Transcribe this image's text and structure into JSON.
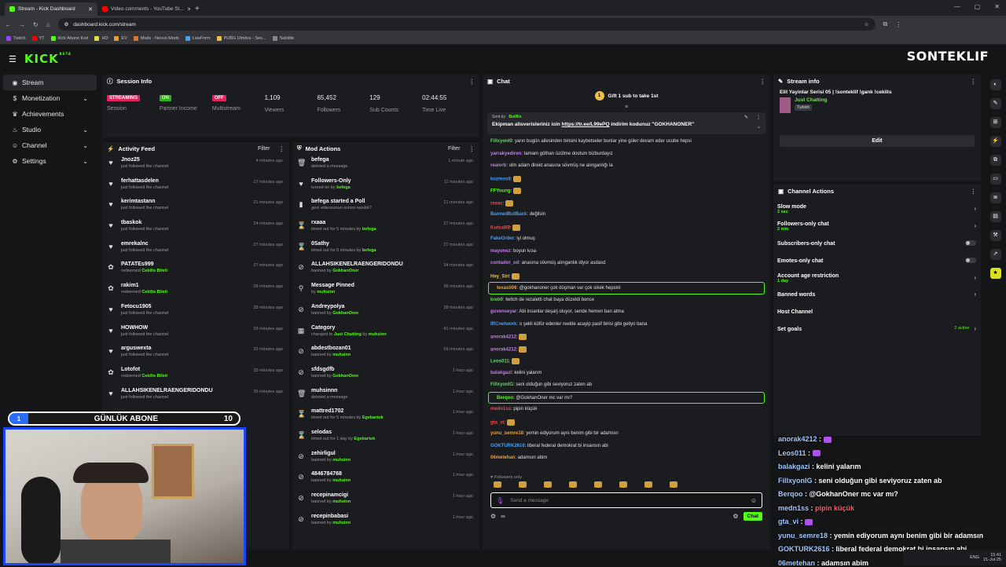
{
  "browser": {
    "tabs": [
      {
        "title": "Stream - Kick Dashboard",
        "active": true,
        "color": "#53fc18"
      },
      {
        "title": "Video comments - YouTube St...",
        "active": false,
        "color": "#ff0000"
      }
    ],
    "url": "dashboard.kick.com/stream",
    "bookmarks": [
      "Twitch",
      "YT",
      "Kick Abone Kod",
      "HD",
      "EV",
      "Mods - Nexus Mods",
      "LawForm",
      "PUBG Ulmbra - Seo...",
      "Subtitle"
    ]
  },
  "brand": {
    "logo": "KICK",
    "beta": "BETA",
    "accent": "#53fc18"
  },
  "streamer_name": "SONTEKLIF",
  "sidebar": {
    "items": [
      {
        "label": "Stream",
        "icon": "broadcast-icon",
        "active": true,
        "chevron": false
      },
      {
        "label": "Monetization",
        "icon": "money-icon",
        "active": false,
        "chevron": true
      },
      {
        "label": "Achievements",
        "icon": "trophy-icon",
        "active": false,
        "chevron": false
      },
      {
        "label": "Studio",
        "icon": "studio-icon",
        "active": false,
        "chevron": true
      },
      {
        "label": "Channel",
        "icon": "user-icon",
        "active": false,
        "chevron": true
      },
      {
        "label": "Settings",
        "icon": "gear-icon",
        "active": false,
        "chevron": true
      }
    ]
  },
  "session": {
    "title": "Session Info",
    "stats": [
      {
        "pill": "STREAMING",
        "pill_color": "#e0245e",
        "value": "",
        "label": "Session"
      },
      {
        "pill": "ON",
        "pill_color": "#2fb31b",
        "value": "",
        "label": "Partner Income"
      },
      {
        "pill": "OFF",
        "pill_color": "#e0245e",
        "value": "",
        "label": "Multistream"
      },
      {
        "pill": "",
        "value": "1,109",
        "label": "Viewers"
      },
      {
        "pill": "",
        "value": "65,452",
        "label": "Followers"
      },
      {
        "pill": "",
        "value": "129",
        "label": "Sub Counts"
      },
      {
        "pill": "",
        "value": "02:44:55",
        "label": "Time Live"
      }
    ]
  },
  "activity": {
    "title": "Activity Feed",
    "filter": "Filter",
    "items": [
      {
        "name": "Jnoz25",
        "sub": "just followed the channel",
        "time": "4 minutes ago",
        "icon": "heart-icon"
      },
      {
        "name": "ferhattasdelen",
        "sub": "just followed the channel",
        "time": "17 minutes ago",
        "icon": "heart-icon"
      },
      {
        "name": "kerimtastann",
        "sub": "just followed the channel",
        "time": "21 minutes ago",
        "icon": "heart-icon"
      },
      {
        "name": "tbaskok",
        "sub": "just followed the channel",
        "time": "24 minutes ago",
        "icon": "heart-icon"
      },
      {
        "name": "emrekalnc",
        "sub": "just followed the channel",
        "time": "27 minutes ago",
        "icon": "heart-icon"
      },
      {
        "name": "PATATEs999",
        "sub": "redeemed",
        "reward": "Cekilis Bileti",
        "time": "27 minutes ago",
        "icon": "reward-icon"
      },
      {
        "name": "rakim1",
        "sub": "redeemed",
        "reward": "Cekilis Bileti",
        "time": "28 minutes ago",
        "icon": "reward-icon"
      },
      {
        "name": "Fetocu1905",
        "sub": "just followed the channel",
        "time": "28 minutes ago",
        "icon": "heart-icon"
      },
      {
        "name": "HOWHOW",
        "sub": "just followed the channel",
        "time": "29 minutes ago",
        "icon": "heart-icon"
      },
      {
        "name": "arguswexta",
        "sub": "just followed the channel",
        "time": "32 minutes ago",
        "icon": "heart-icon"
      },
      {
        "name": "Lotofot",
        "sub": "redeemed",
        "reward": "Cekilis Bileti",
        "time": "35 minutes ago",
        "icon": "reward-icon"
      },
      {
        "name": "ALLAHSIKENELRAENGERIDONDU",
        "sub": "just followed the channel",
        "time": "35 minutes ago",
        "icon": "heart-icon"
      }
    ]
  },
  "mod": {
    "title": "Mod Actions",
    "filter": "Filter",
    "items": [
      {
        "name": "befega",
        "sub": "deleted a message",
        "time": "1 minute ago",
        "icon": "trash-icon"
      },
      {
        "name": "Followers-Only",
        "sub": "turned on by",
        "by": "befega",
        "time": "11 minutes ago",
        "icon": "heart-icon"
      },
      {
        "name": "befega started a Poll",
        "sub": "gezi videosunun süresi nasıldı?",
        "time": "21 minutes ago",
        "icon": "poll-icon"
      },
      {
        "name": "rxaaa",
        "sub": "timed out for 5 minutes by",
        "by": "befega",
        "time": "27 minutes ago",
        "icon": "hourglass-icon"
      },
      {
        "name": "0Sathy",
        "sub": "timed out for 5 minutes by",
        "by": "befega",
        "time": "27 minutes ago",
        "icon": "hourglass-icon"
      },
      {
        "name": "ALLAHSIKENELRAENGERIDONDU",
        "sub": "banned by",
        "by": "GokhanOner",
        "time": "34 minutes ago",
        "icon": "ban-icon"
      },
      {
        "name": "Message Pinned",
        "sub": "by",
        "by": "muhsinn",
        "time": "36 minutes ago",
        "icon": "pin-icon"
      },
      {
        "name": "Andreypolya",
        "sub": "banned by",
        "by": "GokhanOner",
        "time": "38 minutes ago",
        "icon": "ban-icon"
      },
      {
        "name": "Category",
        "sub": "changed to",
        "by": "Just Chatting",
        "extra": "muhsinn",
        "time": "41 minutes ago",
        "icon": "category-icon"
      },
      {
        "name": "abdestbozan01",
        "sub": "banned by",
        "by": "muhsinn",
        "time": "59 minutes ago",
        "icon": "ban-icon"
      },
      {
        "name": "sfdsgdfb",
        "sub": "banned by",
        "by": "GokhanOner",
        "time": "1 hour ago",
        "icon": "ban-icon"
      },
      {
        "name": "muhsinnn",
        "sub": "deleted a message",
        "time": "1 hour ago",
        "icon": "trash-icon"
      },
      {
        "name": "mattred1702",
        "sub": "timed out for 5 minutes by",
        "by": "Egebartok",
        "time": "1 hour ago",
        "icon": "hourglass-icon"
      },
      {
        "name": "selodas",
        "sub": "timed out for 1 day by",
        "by": "Egebartok",
        "time": "1 hour ago",
        "icon": "hourglass-icon"
      },
      {
        "name": "zehirligul",
        "sub": "banned by",
        "by": "muhsinn",
        "time": "1 hour ago",
        "icon": "ban-icon"
      },
      {
        "name": "4846784768",
        "sub": "banned by",
        "by": "muhsinn",
        "time": "1 hour ago",
        "icon": "ban-icon"
      },
      {
        "name": "recepinamcigi",
        "sub": "banned by",
        "by": "muhsinn",
        "time": "1 hour ago",
        "icon": "ban-icon"
      },
      {
        "name": "recepinbabasi",
        "sub": "banned by",
        "by": "muhsinn",
        "time": "1 hour ago",
        "icon": "ban-icon"
      }
    ]
  },
  "chat": {
    "title": "Chat",
    "gift": "Gift 1 sub to take 1st",
    "pinned_sender_label": "Sent by",
    "pinned_sender": "BotRix",
    "pinned_text": "Ekipman alisverisleriniz icin",
    "pinned_link": "https://tr.ee/L99ePQ",
    "pinned_tail": "indirim kodunuz \"GOKHANONER\"",
    "messages": [
      {
        "user": "Fillxyonl0",
        "color": "#6fd16f",
        "text": "yarın bugün ailesinden birisini kaybetseler bunlar yine güler devam eder ucube hepsi"
      },
      {
        "user": "yarrakyediren",
        "color": "#c27ee6",
        "text": "tamam göthan üzülme dostum bizburdayız"
      },
      {
        "user": "realorb",
        "color": "#c27ee6",
        "text": "olm adam direkt anasına sövmüş ne alınganlığı la"
      },
      {
        "user": "kozmosll",
        "color": "#4d9ff0",
        "text": ""
      },
      {
        "user": "FFYoung",
        "color": "#53fc18",
        "text": ""
      },
      {
        "user": "rxeac",
        "color": "#e84d4d",
        "text": ""
      },
      {
        "user": "BannedButBack",
        "color": "#4d9ff0",
        "text": "değilsin"
      },
      {
        "user": "Kutsal69",
        "color": "#e84d4d",
        "text": ""
      },
      {
        "user": "FakeOrder",
        "color": "#4d9ff0",
        "text": "iyi olmuş"
      },
      {
        "user": "mayonez",
        "color": "#c27ee6",
        "text": "boyun kısa"
      },
      {
        "user": "contador_od",
        "color": "#c27ee6",
        "text": "anasına sövmüş alınganlık diyor asdasd"
      },
      {
        "user": "Hey_Siri",
        "color": "#f0c040",
        "text": ""
      },
      {
        "user": "texasli06",
        "color": "#e8a040",
        "text": "@gokhanoner çok düşman var çok sikek hepsini",
        "highlight": true
      },
      {
        "user": "kreb0",
        "color": "#6fd16f",
        "text": "twitch de rezaletti chat baya düzeldi bence"
      },
      {
        "user": "guvenseyar",
        "color": "#c27ee6",
        "text": "Abi insanlar deşarj oluyor, sende hemen ban atma"
      },
      {
        "user": "IRCnetwork",
        "color": "#4d9ff0",
        "text": "o şekli küfür edenler reelde acayip pasif birisi gibi geliyo bana"
      },
      {
        "user": "anorak4212",
        "color": "#c27ee6",
        "text": ""
      },
      {
        "user": "anorak4212",
        "color": "#c27ee6",
        "text": ""
      },
      {
        "user": "Leos011",
        "color": "#6fd16f",
        "text": ""
      },
      {
        "user": "balakgazi",
        "color": "#c27ee6",
        "text": "kelini yalarım"
      },
      {
        "user": "FillxyonIG",
        "color": "#6fd16f",
        "text": "seni olduğun gibi seviyoruz zaten ab"
      },
      {
        "user": "Berqoo",
        "color": "#53fc18",
        "text": "@GokhanOner mc var mı?",
        "highlight": true
      },
      {
        "user": "medn1ss",
        "color": "#e84d4d",
        "text": "pipin küçük"
      },
      {
        "user": "gta_vi",
        "color": "#e84d4d",
        "text": ""
      },
      {
        "user": "yunu_semre18",
        "color": "#e8a040",
        "text": "yemin ediyorum aynı benim gibi bir adamsın"
      },
      {
        "user": "GOKTURK2616",
        "color": "#4d9ff0",
        "text": "liberal federal demokrat bi insansın abi"
      },
      {
        "user": "06metehan",
        "color": "#e8a040",
        "text": "adamsın abim"
      }
    ],
    "followers_only": "Followers only",
    "placeholder": "Send a message",
    "send_label": "Chat"
  },
  "stream_info": {
    "title": "Stream info",
    "stream_title": "Elit Yayinlar Serisi 05 | !sonteklif !gank !cekilis",
    "category": "Just Chatting",
    "language": "Turkish",
    "edit_label": "Edit"
  },
  "channel_actions": {
    "title": "Channel Actions",
    "items": [
      {
        "label": "Slow mode",
        "sub": "2 sec",
        "control": "chevron"
      },
      {
        "label": "Followers-only chat",
        "sub": "2 min",
        "control": "chevron"
      },
      {
        "label": "Subscribers-only chat",
        "sub": "",
        "control": "toggle"
      },
      {
        "label": "Emotes-only chat",
        "sub": "",
        "control": "toggle"
      },
      {
        "label": "Account age restriction",
        "sub": "1 day",
        "control": "chevron"
      },
      {
        "label": "Banned words",
        "sub": "",
        "control": "chevron"
      },
      {
        "label": "Host Channel",
        "sub": "",
        "control": "none"
      },
      {
        "label": "Set goals",
        "sub": "",
        "control": "chevron",
        "badge": "2 active"
      }
    ]
  },
  "overlay_chat": [
    {
      "user": "anorak4212",
      "color": "#b878f0",
      "text": ""
    },
    {
      "user": "Leos011",
      "color": "#fff",
      "text": ""
    },
    {
      "user": "balakgazi",
      "color": "#ffffff",
      "text": "kelini yalarım"
    },
    {
      "user": "FillxyonIG",
      "color": "#ffffff",
      "text": "seni olduğun gibi seviyoruz zaten ab"
    },
    {
      "user": "Berqoo",
      "color": "#ffffff",
      "text": "@GokhanOner mc var mı?"
    },
    {
      "user": "medn1ss",
      "color": "#ff5a5a",
      "text": "pipin küçük"
    },
    {
      "user": "gta_vi",
      "color": "#ff5a5a",
      "text": ""
    },
    {
      "user": "yunu_semre18",
      "color": "#ffffff",
      "text": "yemin ediyorum aynı benim gibi bir adamsın"
    },
    {
      "user": "GOKTURK2616",
      "color": "#ffffff",
      "text": "liberal federal demokrat bi insansın abi"
    },
    {
      "user": "06metehan",
      "color": "#ffffff",
      "text": "adamsın abim"
    }
  ],
  "goal": {
    "current": "1",
    "title": "GÜNLÜK ABONE",
    "target": "10",
    "progress": 0.1
  },
  "taskbar": {
    "lang": "ENG",
    "time": "15:41",
    "date": "21-Jul-25"
  }
}
